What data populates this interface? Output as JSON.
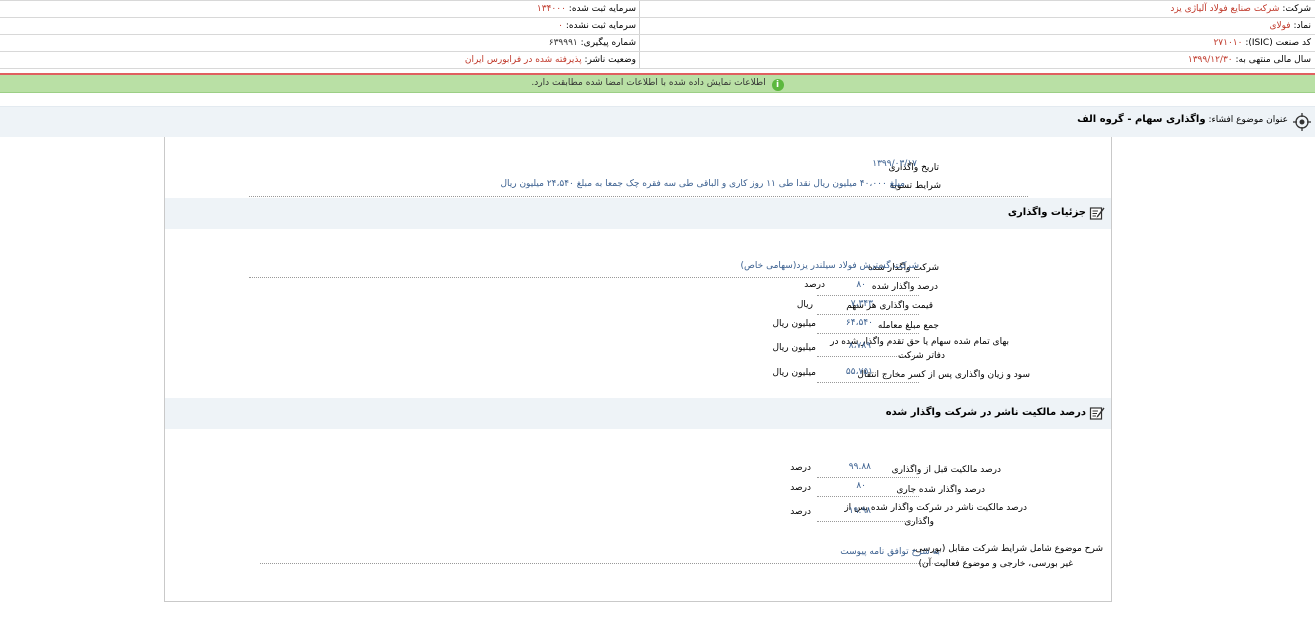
{
  "header": {
    "company_label": "شرکت:",
    "company_value": "شرکت صنایع فولاد آلیاژی یزد",
    "symbol_label": "نماد:",
    "symbol_value": "فولای",
    "isic_label": "کد صنعت (ISIC):",
    "isic_value": "۲۷۱۰۱۰",
    "fiscal_label": "سال مالی منتهی به:",
    "fiscal_value": "۱۳۹۹/۱۲/۳۰",
    "capital_registered_label": "سرمایه ثبت شده:",
    "capital_registered_value": "۱۳۴۰۰۰",
    "capital_unregistered_label": "سرمایه ثبت نشده:",
    "capital_unregistered_value": "۰",
    "tracking_label": "شماره پیگیری:",
    "tracking_value": "۶۳۹۹۹۱",
    "status_label": "وضعیت ناشر:",
    "status_value": "پذیرفته شده در فرابورس ایران"
  },
  "notice": {
    "icon": "info-icon",
    "text": "اطلاعات نمایش داده شده با اطلاعات امضا شده مطابقت دارد.",
    "color": "#b9e0a5"
  },
  "subject": {
    "label": "عنوان موضوع افشاء:",
    "value": "واگذاری سهام - گروه الف"
  },
  "transfer": {
    "date_label": "تاریخ واگذاری",
    "date_value": "۱۳۹۹/۰۳/۱۷",
    "settlement_label": "شرایط تسویه",
    "settlement_value": "مبلغ ۴۰،۰۰۰ میلیون ریال نقدا طی ۱۱ روز کاری و الباقی طی سه فقره چک جمعا به مبلغ ۲۴،۵۴۰ میلیون ریال"
  },
  "details": {
    "title": "جزئیات واگذاری",
    "company_label": "شرکت واگذار شده",
    "company_value": "شرکت گسترش فولاد سیلندر یزد(سهامی خاص)",
    "rows": [
      {
        "label": "درصد واگذار شده",
        "value": "۸۰",
        "unit": "درصد"
      },
      {
        "label": "قیمت واگذاری هر سهم",
        "value": "۷،۳۴۳",
        "unit": "ریال"
      },
      {
        "label": "جمع مبلغ معامله",
        "value": "۶۴،۵۴۰",
        "unit": "میلیون ریال"
      },
      {
        "label1": "بهای تمام شده سهام یا حق تقدم واگذار شده در",
        "label2": "دفاتر شرکت",
        "value": "۸،۷۸۹",
        "unit": "میلیون ریال"
      },
      {
        "label": "سود و زیان واگذاری پس از کسر مخارج انتقال",
        "value": "۵۵،۷۵۱",
        "unit": "میلیون ریال"
      }
    ]
  },
  "ownership": {
    "title": "درصد مالکیت ناشر در شرکت واگذار شده",
    "rows": [
      {
        "label": "درصد مالکیت قبل از واگذاری",
        "value": "۹۹.۸۸",
        "unit": "درصد"
      },
      {
        "label": "درصد واگذار شده جاری",
        "value": "۸۰",
        "unit": "درصد"
      },
      {
        "label1": "درصد مالکیت ناشر در شرکت واگذار شده پس از",
        "label2": "واگذاری",
        "value": "۱۹.۹۸",
        "unit": "درصد"
      }
    ],
    "desc_label1": "شرح موضوع شامل شرایط شرکت مقابل (بورسی،",
    "desc_label2": "غیر بورسی، خارجی و موضوع فعالیت آن)",
    "desc_value": "به شرح توافق نامه پیوست"
  }
}
